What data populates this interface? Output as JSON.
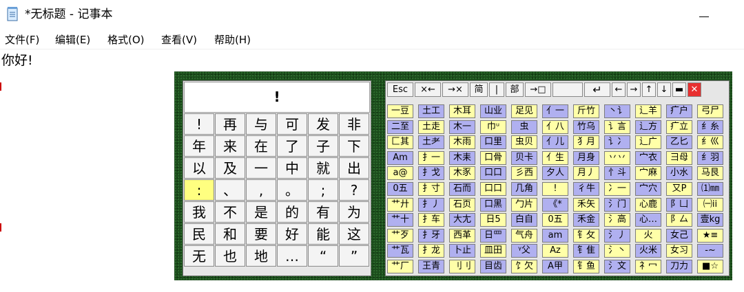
{
  "window": {
    "title": "*无标题 - 记事本"
  },
  "menu": [
    "文件(F)",
    "编辑(E)",
    "格式(O)",
    "查看(V)",
    "帮助(H)"
  ],
  "document": {
    "text": "你好!"
  },
  "keyboard": {
    "display": "!",
    "selected_index": 18,
    "chars": [
      "!",
      "再",
      "与",
      "可",
      "发",
      "非",
      "年",
      "来",
      "在",
      "了",
      "子",
      "下",
      "以",
      "及",
      "一",
      "中",
      "就",
      "出",
      ":",
      "、",
      ",",
      "。",
      ";",
      "?",
      "我",
      "不",
      "是",
      "的",
      "有",
      "为",
      "民",
      "和",
      "要",
      "好",
      "能",
      "这",
      "无",
      "也",
      "地",
      "…",
      "“",
      "”"
    ],
    "toolbar": [
      {
        "label": "Esc",
        "name": "esc-key",
        "w": 38
      },
      {
        "label": "×←",
        "name": "delete-left-key",
        "w": 38
      },
      {
        "label": "→×",
        "name": "delete-right-key",
        "w": 38
      },
      {
        "label": "简",
        "name": "simplified-key",
        "w": 26
      },
      {
        "label": "|",
        "name": "separator-key",
        "w": 22
      },
      {
        "label": "部",
        "name": "radical-key",
        "w": 26
      },
      {
        "label": "→□",
        "name": "tab-key",
        "w": 38
      },
      {
        "label": "",
        "name": "blank-key",
        "w": 44
      },
      {
        "label": "↵",
        "name": "enter-key",
        "w": 38
      },
      {
        "label": "←",
        "name": "arrow-left-key",
        "w": 20
      },
      {
        "label": "→",
        "name": "arrow-right-key",
        "w": 20
      },
      {
        "label": "↑",
        "name": "arrow-up-key",
        "w": 20
      },
      {
        "label": "↓",
        "name": "arrow-down-key",
        "w": 20
      },
      {
        "label": "▬",
        "name": "minimize-keyboard-key",
        "w": 20
      },
      {
        "label": "✕",
        "name": "close-keyboard-key",
        "w": 20
      }
    ],
    "columns": [
      [
        "一豆",
        "二至",
        "匚其",
        "Am",
        "a@",
        "0五",
        "艹廾",
        "艹十",
        "艹歹",
        "艹瓦",
        "艹厂"
      ],
      [
        "土工",
        "土走",
        "土耂",
        "扌一",
        "扌戈",
        "扌寸",
        "扌丿",
        "扌车",
        "扌牙",
        "扌龙",
        "王青"
      ],
      [
        "木耳",
        "木一",
        "木雨",
        "木耒",
        "木豕",
        "石而",
        "石页",
        "大尢",
        "西革",
        "卜止",
        "刂刂"
      ],
      [
        "山业",
        "巾ᵘ",
        "口里",
        "口骨",
        "口口",
        "口口",
        "口黑",
        "日5",
        "日罒",
        "皿田",
        "目齿"
      ],
      [
        "足见",
        "虫",
        "虫贝",
        "贝卡",
        "彡西",
        "几角",
        "勹片",
        "白自",
        "气舟",
        "ᵞ父",
        "饣欠"
      ],
      [
        "亻一",
        "亻八",
        "亻儿",
        "亻生",
        "夕人",
        "!",
        "《*",
        "0五",
        "am",
        "Az",
        "A甲"
      ],
      [
        "斤竹",
        "竹乌",
        "犭月",
        "月身",
        "月丿",
        "彳牛",
        "禾矢",
        "禾金",
        "钅攵",
        "钅隹",
        "钅鱼"
      ],
      [
        "丶讠",
        "讠言",
        "讠冫",
        "丷丷",
        "忄斗",
        "冫一",
        "氵门",
        "氵高",
        "氵丿",
        "氵丶",
        "氵文"
      ],
      [
        "辶羊",
        "辶方",
        "辶广",
        "宀衣",
        "宀麻",
        "宀穴",
        "心鹿",
        "心…",
        "火",
        "火米",
        "礻冖"
      ],
      [
        "疒户",
        "疒立",
        "乙匕",
        "彐母",
        "小水",
        "又P",
        "阝凵",
        "阝厶",
        "女己",
        "女习",
        "刀力"
      ],
      [
        "弓尸",
        "纟糸",
        "纟巛",
        "纟羽",
        "马艮",
        "⑴㎜",
        "㈠ii",
        "壹kg",
        "★≡",
        "-~",
        "■☆"
      ]
    ],
    "colors": {
      "yellow": "#ffffa8",
      "blue": "#b0b0f0",
      "selected": "#ffff80",
      "background": "#1c4d1c"
    }
  }
}
